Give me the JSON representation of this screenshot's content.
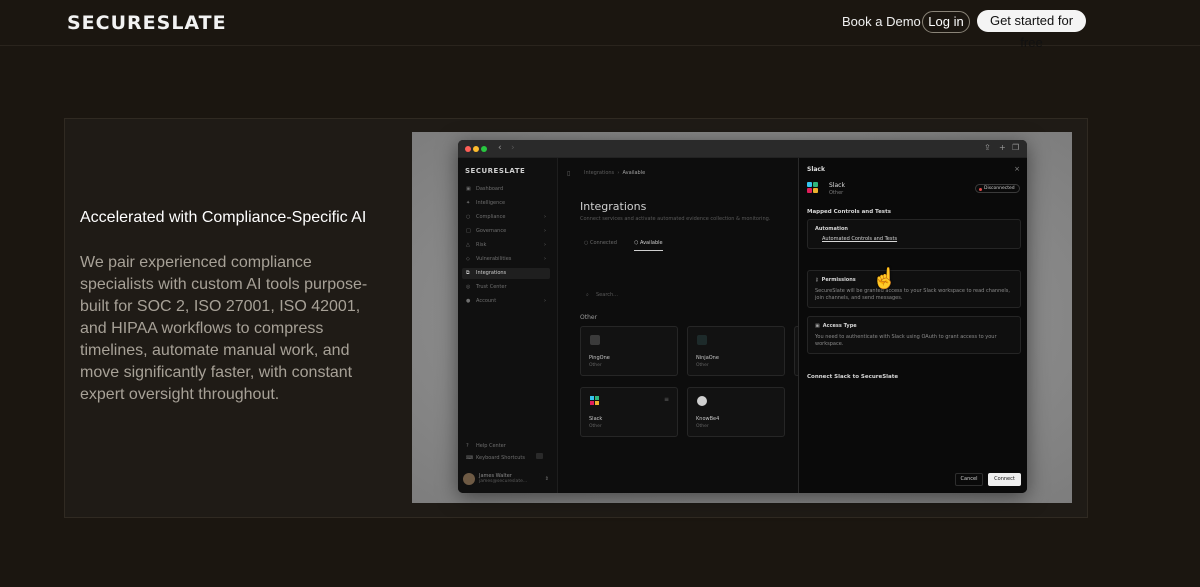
{
  "nav": {
    "logo": "SECURESLATE",
    "book_demo": "Book a Demo",
    "login": "Log in",
    "get_started": "Get started for free"
  },
  "hero": {
    "headline": "Accelerated with Compliance-Specific AI",
    "body": "We pair experienced compliance specialists with custom AI tools purpose-built for SOC 2, ISO 27001, ISO 42001, and HIPAA workflows to compress timelines, automate manual work, and move significantly faster, with constant expert oversight throughout."
  },
  "app": {
    "logo": "SECURESLATE",
    "sidebar": {
      "items": [
        {
          "label": "Dashboard",
          "icon": "▣",
          "chevron": ""
        },
        {
          "label": "Intelligence",
          "icon": "✦",
          "chevron": ""
        },
        {
          "label": "Compliance",
          "icon": "○",
          "chevron": "›"
        },
        {
          "label": "Governance",
          "icon": "□",
          "chevron": "›"
        },
        {
          "label": "Risk",
          "icon": "△",
          "chevron": "›"
        },
        {
          "label": "Vulnerabilities",
          "icon": "◇",
          "chevron": "›"
        },
        {
          "label": "Integrations",
          "icon": "⧉",
          "chevron": ""
        },
        {
          "label": "Trust Center",
          "icon": "◎",
          "chevron": ""
        },
        {
          "label": "Account",
          "icon": "●",
          "chevron": "›"
        }
      ],
      "help": "Help Center",
      "shortcuts": "Keyboard Shortcuts",
      "user_name": "James Walter",
      "user_email": "james@secureslate..."
    },
    "breadcrumb": {
      "parent": "Integrations",
      "sep": "›",
      "current": "Available"
    },
    "title": "Integrations",
    "subtitle": "Connect services and activate automated evidence collection & monitoring.",
    "tabs": [
      {
        "label": "Connected",
        "icon": "○"
      },
      {
        "label": "Available",
        "icon": "⬡"
      }
    ],
    "search_placeholder": "Search...",
    "section": "Other",
    "tiles": [
      {
        "name": "PingOne",
        "category": "Other"
      },
      {
        "name": "NinjaOne",
        "category": "Other"
      },
      {
        "name": "Slack",
        "category": "Other",
        "menu": "≡"
      },
      {
        "name": "KnowBe4",
        "category": "Other"
      }
    ],
    "drawer": {
      "title": "Slack",
      "close": "×",
      "name": "Slack",
      "category": "Other",
      "status": "Disconnected",
      "status_color": "#e14b4b",
      "mapped_heading": "Mapped Controls and Tests",
      "automation_heading": "Automation",
      "automation_link": "Automated Controls and Tests",
      "permissions_heading": "Permissions",
      "permissions_text": "SecureSlate will be granted access to your Slack workspace to read channels, join channels, and send messages.",
      "access_heading": "Access Type",
      "access_text": "You need to authenticate with Slack using OAuth to grant access to your workspace.",
      "connect_heading": "Connect Slack to SecureSlate",
      "cancel": "Cancel",
      "connect": "Connect"
    }
  }
}
